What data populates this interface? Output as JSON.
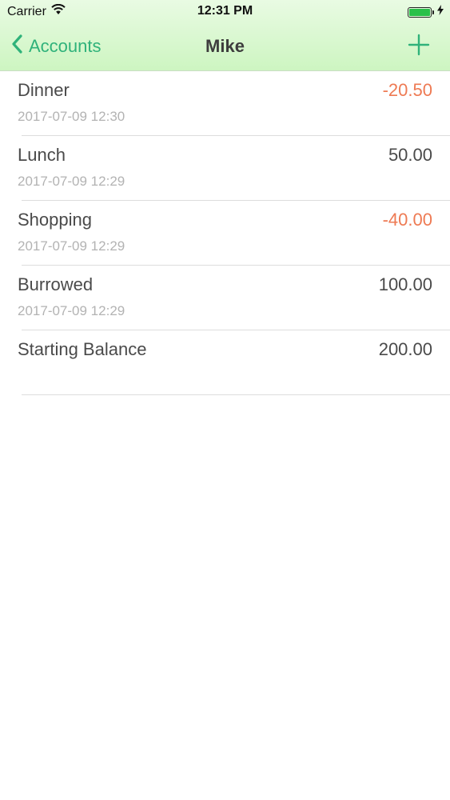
{
  "status_bar": {
    "carrier": "Carrier",
    "time": "12:31 PM",
    "battery_level": 1.0
  },
  "nav": {
    "back_label": "Accounts",
    "title": "Mike",
    "add_icon": "plus-icon"
  },
  "colors": {
    "accent": "#2fb27a",
    "negative": "#ee7a53",
    "nav_bg_top": "#e9fbe3",
    "nav_bg_bottom": "#cdf5c1"
  },
  "transactions": [
    {
      "title": "Dinner",
      "date": "2017-07-09 12:30",
      "amount": "-20.50",
      "negative": true
    },
    {
      "title": "Lunch",
      "date": "2017-07-09 12:29",
      "amount": "50.00",
      "negative": false
    },
    {
      "title": "Shopping",
      "date": "2017-07-09 12:29",
      "amount": "-40.00",
      "negative": true
    },
    {
      "title": "Burrowed",
      "date": "2017-07-09 12:29",
      "amount": "100.00",
      "negative": false
    },
    {
      "title": "Starting Balance",
      "date": "",
      "amount": "200.00",
      "negative": false
    }
  ]
}
